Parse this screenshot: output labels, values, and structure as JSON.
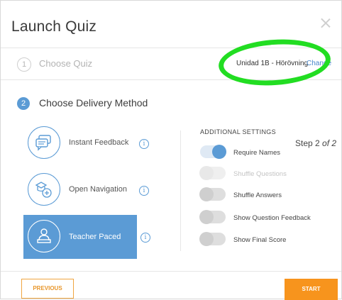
{
  "header": {
    "title": "Launch Quiz"
  },
  "step1": {
    "number": "1",
    "label": "Choose Quiz",
    "quiz_name": "Unidad 1B - Hörövning",
    "change_label": "Change"
  },
  "step2": {
    "number": "2",
    "label": "Choose Delivery Method"
  },
  "methods": [
    {
      "label": "Instant Feedback",
      "icon": "chat-bubbles-icon",
      "selected": false
    },
    {
      "label": "Open Navigation",
      "icon": "open-navigation-icon",
      "selected": false
    },
    {
      "label": "Teacher Paced",
      "icon": "teacher-icon",
      "selected": true
    }
  ],
  "info_glyph": "i",
  "settings": {
    "title": "ADDITIONAL SETTINGS",
    "step_text": "Step 2",
    "step_of": "of 2",
    "items": [
      {
        "label": "Require Names",
        "state": "on"
      },
      {
        "label": "Shuffle Questions",
        "state": "disabled"
      },
      {
        "label": "Shuffle Answers",
        "state": "off"
      },
      {
        "label": "Show Question Feedback",
        "state": "off"
      },
      {
        "label": "Show Final Score",
        "state": "off"
      }
    ]
  },
  "footer": {
    "previous_label": "PREVIOUS",
    "start_label": "START"
  },
  "colors": {
    "accent": "#5b9bd5",
    "orange": "#f7941d",
    "highlight_ellipse": "#22dd22"
  }
}
